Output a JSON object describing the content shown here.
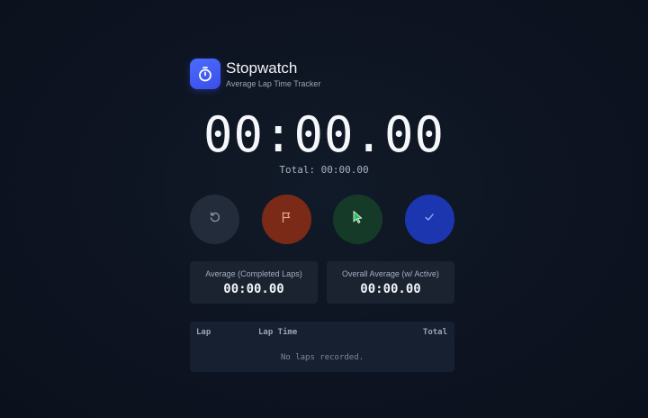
{
  "app": {
    "title": "Stopwatch",
    "subtitle": "Average Lap Time Tracker",
    "logo_icon": "stopwatch-icon"
  },
  "timer": {
    "display": "00:00.00",
    "total_label": "Total: 00:00.00"
  },
  "controls": [
    {
      "name": "reset",
      "icon": "reset-icon",
      "color": "#232c3a"
    },
    {
      "name": "lap",
      "icon": "flag-icon",
      "color": "#7a2a17"
    },
    {
      "name": "start",
      "icon": "play-cursor-icon",
      "color": "#163a28"
    },
    {
      "name": "done",
      "icon": "check-icon",
      "color": "#1c36b0"
    }
  ],
  "stats": {
    "avg_completed_label": "Average (Completed Laps)",
    "avg_completed_value": "00:00.00",
    "overall_avg_label": "Overall Average (w/ Active)",
    "overall_avg_value": "00:00.00"
  },
  "laps_table": {
    "headers": {
      "lap": "Lap",
      "lap_time": "Lap Time",
      "total": "Total"
    },
    "empty_message": "No laps recorded.",
    "rows": []
  }
}
